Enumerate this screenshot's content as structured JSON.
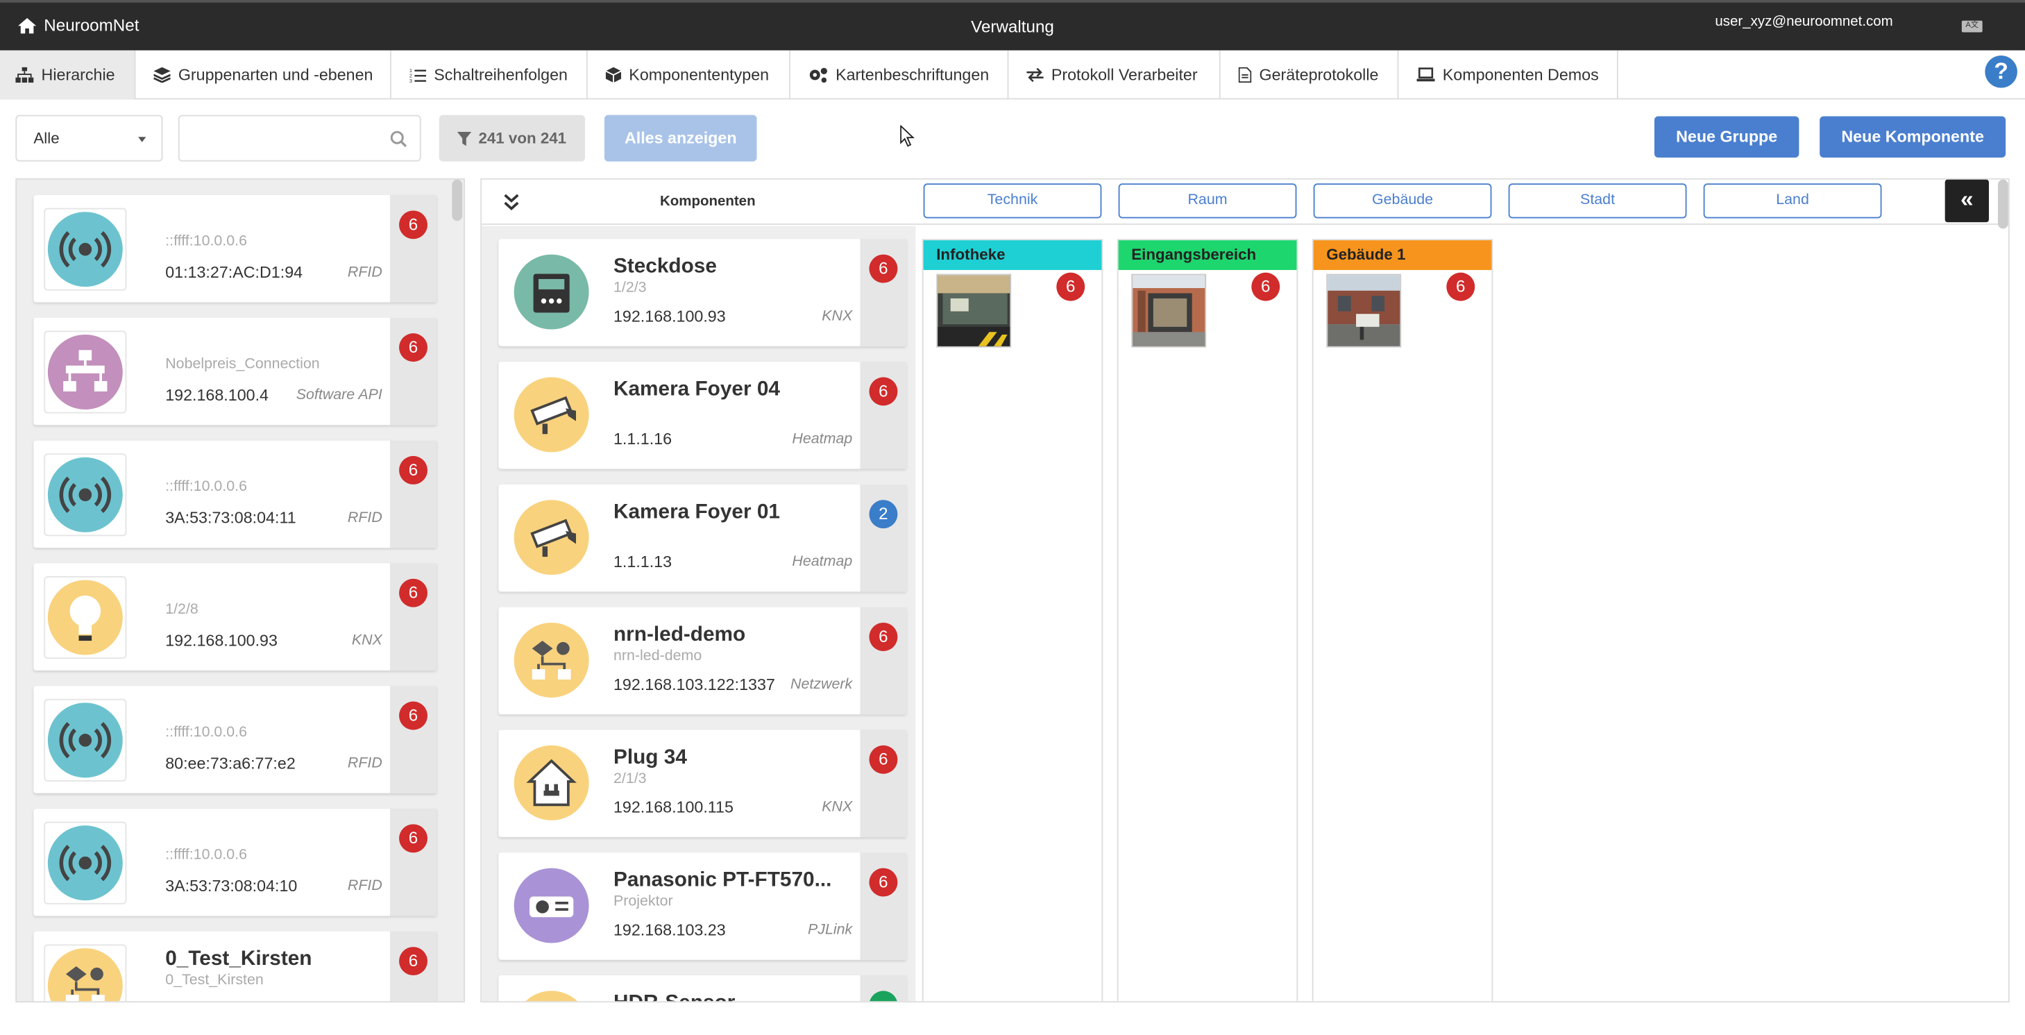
{
  "header": {
    "brand": "NeuroomNet",
    "title": "Verwaltung",
    "user": "user_xyz@neuroomnet.com",
    "lang_icon": "A文"
  },
  "tabs": [
    {
      "label": "Hierarchie",
      "icon": "sitemap-icon"
    },
    {
      "label": "Gruppenarten und -ebenen",
      "icon": "layers-icon"
    },
    {
      "label": "Schaltreihenfolgen",
      "icon": "list-ordered-icon"
    },
    {
      "label": "Komponententypen",
      "icon": "cube-icon"
    },
    {
      "label": "Kartenbeschriftungen",
      "icon": "gears-icon"
    },
    {
      "label": "Protokoll Verarbeiter",
      "icon": "exchange-icon"
    },
    {
      "label": "Geräteprotokolle",
      "icon": "document-icon"
    },
    {
      "label": "Komponenten Demos",
      "icon": "laptop-icon"
    }
  ],
  "help_label": "?",
  "toolbar": {
    "select_value": "Alle",
    "search_placeholder": "",
    "count_label": "241 von 241",
    "show_all_label": "Alles anzeigen",
    "new_group_label": "Neue Gruppe",
    "new_component_label": "Neue Komponente"
  },
  "left_list": [
    {
      "name": "",
      "sub": "::ffff:10.0.0.6",
      "addr": "01:13:27:AC:D1:94",
      "proto": "RFID",
      "badge": "6",
      "badge_color": "red",
      "icon": "rfid-icon",
      "icon_color": "#6cc3cf"
    },
    {
      "name": "",
      "sub": "Nobelpreis_Connection",
      "addr": "192.168.100.4",
      "proto": "Software API",
      "badge": "6",
      "badge_color": "red",
      "icon": "network-icon",
      "icon_color": "#c38fbc"
    },
    {
      "name": "",
      "sub": "::ffff:10.0.0.6",
      "addr": "3A:53:73:08:04:11",
      "proto": "RFID",
      "badge": "6",
      "badge_color": "red",
      "icon": "rfid-icon",
      "icon_color": "#6cc3cf"
    },
    {
      "name": "",
      "sub": "1/2/8",
      "addr": "192.168.100.93",
      "proto": "KNX",
      "badge": "6",
      "badge_color": "red",
      "icon": "lightbulb-icon",
      "icon_color": "#f9d27e"
    },
    {
      "name": "",
      "sub": "::ffff:10.0.0.6",
      "addr": "80:ee:73:a6:77:e2",
      "proto": "RFID",
      "badge": "6",
      "badge_color": "red",
      "icon": "rfid-icon",
      "icon_color": "#6cc3cf"
    },
    {
      "name": "",
      "sub": "::ffff:10.0.0.6",
      "addr": "3A:53:73:08:04:10",
      "proto": "RFID",
      "badge": "6",
      "badge_color": "red",
      "icon": "rfid-icon",
      "icon_color": "#6cc3cf"
    },
    {
      "name": "0_Test_Kirsten",
      "sub": "0_Test_Kirsten",
      "addr": "",
      "proto": "",
      "badge": "6",
      "badge_color": "red",
      "icon": "flow-icon",
      "icon_color": "#f9d27e"
    }
  ],
  "right_header": {
    "column_label": "Komponenten",
    "filters": [
      "Technik",
      "Raum",
      "Gebäude",
      "Stadt",
      "Land"
    ],
    "collapse_label": "«"
  },
  "components": [
    {
      "name": "Steckdose",
      "sub": "1/2/3",
      "addr": "192.168.100.93",
      "proto": "KNX",
      "badge": "6",
      "badge_color": "red",
      "icon": "outlet-device-icon",
      "icon_color": "#79b9a8"
    },
    {
      "name": "Kamera Foyer 04",
      "sub": "",
      "addr": "1.1.1.16",
      "proto": "Heatmap",
      "badge": "6",
      "badge_color": "red",
      "icon": "camera-icon",
      "icon_color": "#f9d27e"
    },
    {
      "name": "Kamera Foyer 01",
      "sub": "",
      "addr": "1.1.1.13",
      "proto": "Heatmap",
      "badge": "2",
      "badge_color": "blue",
      "icon": "camera-icon",
      "icon_color": "#f9d27e"
    },
    {
      "name": "nrn-led-demo",
      "sub": "nrn-led-demo",
      "addr": "192.168.103.122:1337",
      "proto": "Netzwerk",
      "badge": "6",
      "badge_color": "red",
      "icon": "flow-icon",
      "icon_color": "#f9d27e"
    },
    {
      "name": "Plug 34",
      "sub": "2/1/3",
      "addr": "192.168.100.115",
      "proto": "KNX",
      "badge": "6",
      "badge_color": "red",
      "icon": "plug-icon",
      "icon_color": "#f9d27e"
    },
    {
      "name": "Panasonic PT-FT570...",
      "sub": "Projektor",
      "addr": "192.168.103.23",
      "proto": "PJLink",
      "badge": "6",
      "badge_color": "red",
      "icon": "projector-icon",
      "icon_color": "#a993d6"
    },
    {
      "name": "HDR-Sensor",
      "sub": "",
      "addr": "",
      "proto": "",
      "badge": "",
      "badge_color": "green",
      "icon": "flow-icon",
      "icon_color": "#f9d27e"
    }
  ],
  "groups": [
    {
      "name": "Infotheke",
      "color": "#1ecfd3",
      "badge": "6"
    },
    {
      "name": "Eingangsbereich",
      "color": "#1dd66e",
      "badge": "6"
    },
    {
      "name": "Gebäude 1",
      "color": "#f7941d",
      "badge": "6"
    }
  ]
}
